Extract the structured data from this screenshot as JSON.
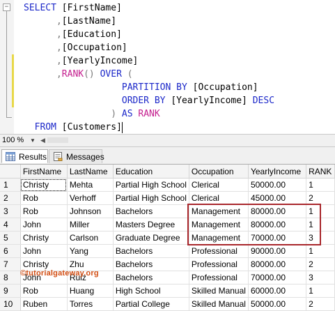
{
  "editor": {
    "lines": [
      {
        "parts": [
          {
            "t": "SELECT ",
            "c": "kw"
          },
          {
            "t": "[FirstName]",
            "c": ""
          }
        ]
      },
      {
        "parts": [
          {
            "t": "      ,",
            "c": "gray"
          },
          {
            "t": "[LastName]",
            "c": ""
          }
        ]
      },
      {
        "parts": [
          {
            "t": "      ,",
            "c": "gray"
          },
          {
            "t": "[Education]",
            "c": ""
          }
        ]
      },
      {
        "parts": [
          {
            "t": "      ,",
            "c": "gray"
          },
          {
            "t": "[Occupation]",
            "c": ""
          }
        ]
      },
      {
        "parts": [
          {
            "t": "      ,",
            "c": "gray"
          },
          {
            "t": "[YearlyIncome]",
            "c": ""
          }
        ]
      },
      {
        "parts": [
          {
            "t": "      ,",
            "c": "gray"
          },
          {
            "t": "RANK",
            "c": "fn"
          },
          {
            "t": "() ",
            "c": "gray"
          },
          {
            "t": "OVER ",
            "c": "kw"
          },
          {
            "t": "(",
            "c": "gray"
          }
        ]
      },
      {
        "parts": [
          {
            "t": "                  PARTITION BY ",
            "c": "kw"
          },
          {
            "t": "[Occupation]",
            "c": ""
          }
        ]
      },
      {
        "parts": [
          {
            "t": "                  ORDER BY ",
            "c": "kw"
          },
          {
            "t": "[YearlyIncome] ",
            "c": ""
          },
          {
            "t": "DESC",
            "c": "kw"
          }
        ]
      },
      {
        "parts": [
          {
            "t": "                ) ",
            "c": "gray"
          },
          {
            "t": "AS ",
            "c": "kw"
          },
          {
            "t": "RANK",
            "c": "fn"
          }
        ]
      },
      {
        "parts": [
          {
            "t": "  FROM ",
            "c": "kw"
          },
          {
            "t": "[Customers]",
            "c": ""
          }
        ]
      }
    ]
  },
  "zoom": {
    "value": "100 %"
  },
  "tabs": [
    {
      "label": "Results",
      "active": true
    },
    {
      "label": "Messages",
      "active": false
    }
  ],
  "grid": {
    "columns": [
      "",
      "FirstName",
      "LastName",
      "Education",
      "Occupation",
      "YearlyIncome",
      "RANK"
    ],
    "rows": [
      [
        "1",
        "Christy",
        "Mehta",
        "Partial High School",
        "Clerical",
        "50000.00",
        "1"
      ],
      [
        "2",
        "Rob",
        "Verhoff",
        "Partial High School",
        "Clerical",
        "45000.00",
        "2"
      ],
      [
        "3",
        "Rob",
        "Johnson",
        "Bachelors",
        "Management",
        "80000.00",
        "1"
      ],
      [
        "4",
        "John",
        "Miller",
        "Masters Degree",
        "Management",
        "80000.00",
        "1"
      ],
      [
        "5",
        "Christy",
        "Carlson",
        "Graduate Degree",
        "Management",
        "70000.00",
        "3"
      ],
      [
        "6",
        "John",
        "Yang",
        "Bachelors",
        "Professional",
        "90000.00",
        "1"
      ],
      [
        "7",
        "Christy",
        "Zhu",
        "Bachelors",
        "Professional",
        "80000.00",
        "2"
      ],
      [
        "8",
        "John",
        "Ruiz",
        "Bachelors",
        "Professional",
        "70000.00",
        "3"
      ],
      [
        "9",
        "Rob",
        "Huang",
        "High School",
        "Skilled Manual",
        "60000.00",
        "1"
      ],
      [
        "10",
        "Ruben",
        "Torres",
        "Partial College",
        "Skilled Manual",
        "50000.00",
        "2"
      ]
    ]
  },
  "watermark": "©tutorialgateway.org",
  "colors": {
    "keyword": "#1b27c9",
    "function": "#c41e8e",
    "highlight": "#a8262b",
    "watermark": "#d34e13"
  }
}
